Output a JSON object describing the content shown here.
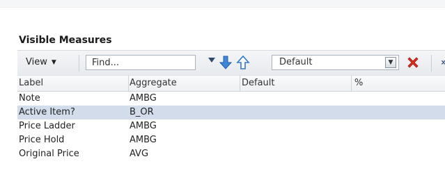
{
  "panel": {
    "title": "Visible Measures"
  },
  "toolbar": {
    "view_label": "View",
    "find_placeholder": "Find...",
    "select_value": "Default",
    "overflow": "»"
  },
  "table": {
    "columns": [
      "Label",
      "Aggregate",
      "Default",
      "%"
    ],
    "rows": [
      {
        "label": "Note",
        "aggregate": "AMBG",
        "default": "",
        "percent": ""
      },
      {
        "label": "Active Item?",
        "aggregate": "B_OR",
        "default": "",
        "percent": "",
        "selected": true
      },
      {
        "label": "Price Ladder",
        "aggregate": "AMBG",
        "default": "",
        "percent": ""
      },
      {
        "label": "Price Hold",
        "aggregate": "AMBG",
        "default": "",
        "percent": ""
      },
      {
        "label": "Original Price",
        "aggregate": "AVG",
        "default": "",
        "percent": ""
      }
    ],
    "selected_row_color": "#d3dceb"
  },
  "icons": {
    "down_arrow": "arrow-down-icon",
    "up_arrow": "arrow-up-icon",
    "delete": "delete-x-icon",
    "dropdown": "chevron-down-icon"
  },
  "colors": {
    "arrow_blue": "#3d86d8",
    "delete_red": "#d7301f"
  }
}
